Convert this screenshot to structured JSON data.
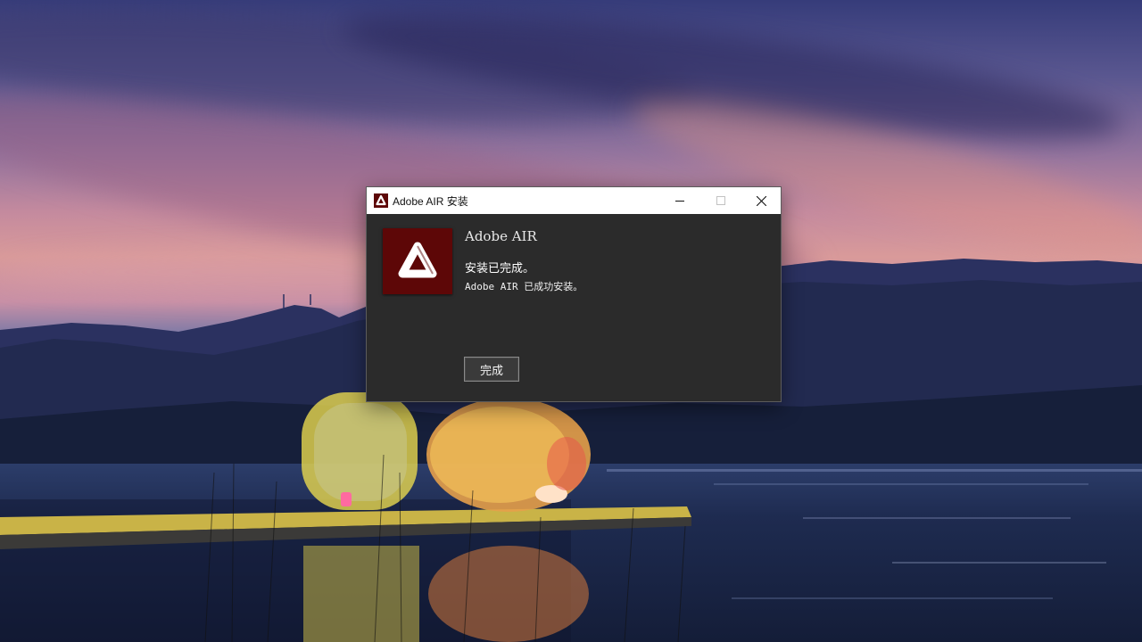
{
  "window": {
    "title": "Adobe AIR 安装",
    "icon": "adobe-air-icon"
  },
  "window_controls": {
    "minimize_icon": "minimize-icon",
    "maximize_icon": "maximize-icon",
    "close_icon": "close-icon"
  },
  "dialog": {
    "logo": "adobe-air-logo",
    "logo_color": "#5d0707",
    "app_name": "Adobe AIR",
    "status_title": "安装已完成。",
    "status_detail": "Adobe AIR 已成功安装。",
    "done_button_label": "完成"
  }
}
